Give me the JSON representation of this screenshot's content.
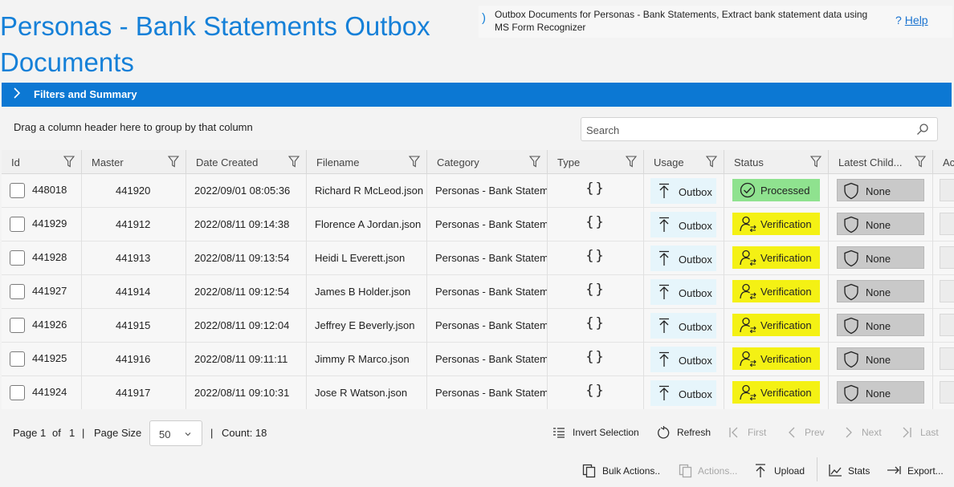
{
  "page": {
    "title": "Personas - Bank Statements Outbox Documents",
    "description": "Outbox Documents for Personas - Bank Statements, Extract bank statement data using MS Form Recognizer",
    "help_icon": "?",
    "help_label": "Help"
  },
  "filters": {
    "label": "Filters and Summary",
    "icon": "chevron-right-icon"
  },
  "grid_toolbar": {
    "group_hint": "Drag a column header here to group by that column",
    "search_placeholder": "Search"
  },
  "columns": [
    "Id",
    "Master",
    "Date Created",
    "Filename",
    "Category",
    "Type",
    "Usage",
    "Status",
    "Latest Child...",
    "Ac"
  ],
  "rows": [
    {
      "id": "448018",
      "master": "441920",
      "date": "2022/09/01 08:05:36",
      "filename": "Richard R McLeod.json",
      "category": "Personas - Bank Statements",
      "type": "{}",
      "usage": "Outbox",
      "status": "Processed",
      "child": "None"
    },
    {
      "id": "441929",
      "master": "441912",
      "date": "2022/08/11 09:14:38",
      "filename": "Florence A Jordan.json",
      "category": "Personas - Bank Statements",
      "type": "{}",
      "usage": "Outbox",
      "status": "Verification",
      "child": "None"
    },
    {
      "id": "441928",
      "master": "441913",
      "date": "2022/08/11 09:13:54",
      "filename": "Heidi L Everett.json",
      "category": "Personas - Bank Statements",
      "type": "{}",
      "usage": "Outbox",
      "status": "Verification",
      "child": "None"
    },
    {
      "id": "441927",
      "master": "441914",
      "date": "2022/08/11 09:12:54",
      "filename": "James B Holder.json",
      "category": "Personas - Bank Statements",
      "type": "{}",
      "usage": "Outbox",
      "status": "Verification",
      "child": "None"
    },
    {
      "id": "441926",
      "master": "441915",
      "date": "2022/08/11 09:12:04",
      "filename": "Jeffrey E Beverly.json",
      "category": "Personas - Bank Statements",
      "type": "{}",
      "usage": "Outbox",
      "status": "Verification",
      "child": "None"
    },
    {
      "id": "441925",
      "master": "441916",
      "date": "2022/08/11 09:11:11",
      "filename": "Jimmy R Marco.json",
      "category": "Personas - Bank Statements",
      "type": "{}",
      "usage": "Outbox",
      "status": "Verification",
      "child": "None"
    },
    {
      "id": "441924",
      "master": "441917",
      "date": "2022/08/11 09:10:31",
      "filename": "Jose R Watson.json",
      "category": "Personas - Bank Statements",
      "type": "{}",
      "usage": "Outbox",
      "status": "Verification",
      "child": "None"
    }
  ],
  "colors": {
    "accent": "#0c78d3",
    "title": "#1580d8",
    "status_processed": "#8fe28f",
    "status_verification": "#f4f114",
    "child_none": "#c9c9c9",
    "usage_bg": "#e6f5fb"
  },
  "pager": {
    "page_label": "Page",
    "page": "1",
    "of_label": "of",
    "total_pages": "1",
    "sep": "|",
    "page_size_label": "Page Size",
    "page_size": "50",
    "count_label": "Count: 18",
    "invert_selection": "Invert Selection",
    "refresh": "Refresh",
    "first": "First",
    "prev": "Prev",
    "next": "Next",
    "last": "Last"
  },
  "actions": {
    "bulk": "Bulk Actions..",
    "actions": "Actions...",
    "upload": "Upload",
    "stats": "Stats",
    "export": "Export..."
  }
}
